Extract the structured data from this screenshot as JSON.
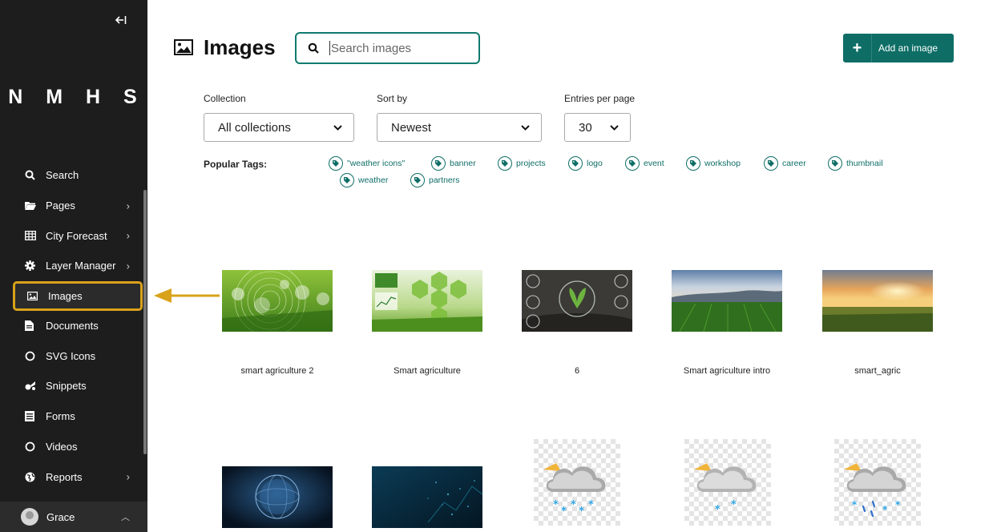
{
  "sidebar": {
    "brand": "N M H S",
    "collapse_glyph": "⇤",
    "items": [
      {
        "label": "Search",
        "icon": "search-icon",
        "has_submenu": false
      },
      {
        "label": "Pages",
        "icon": "folder-icon",
        "has_submenu": true
      },
      {
        "label": "City Forecast",
        "icon": "table-icon",
        "has_submenu": true
      },
      {
        "label": "Layer Manager",
        "icon": "gear-icon",
        "has_submenu": true
      },
      {
        "label": "Images",
        "icon": "image-icon",
        "has_submenu": false,
        "active": true
      },
      {
        "label": "Documents",
        "icon": "document-icon",
        "has_submenu": false
      },
      {
        "label": "SVG Icons",
        "icon": "circle-icon",
        "has_submenu": false
      },
      {
        "label": "Snippets",
        "icon": "snippet-icon",
        "has_submenu": false
      },
      {
        "label": "Forms",
        "icon": "form-icon",
        "has_submenu": false
      },
      {
        "label": "Videos",
        "icon": "circle-icon",
        "has_submenu": false
      },
      {
        "label": "Reports",
        "icon": "globe-icon",
        "has_submenu": true
      }
    ],
    "user": {
      "name": "Grace"
    }
  },
  "header": {
    "title": "Images",
    "search_placeholder": "Search images",
    "add_button": "Add an image"
  },
  "filters": {
    "collection": {
      "label": "Collection",
      "value": "All collections"
    },
    "sort": {
      "label": "Sort by",
      "value": "Newest"
    },
    "entries": {
      "label": "Entries per page",
      "value": "30"
    }
  },
  "tags": {
    "label": "Popular Tags:",
    "items": [
      "\"weather icons\"",
      "banner",
      "projects",
      "logo",
      "event",
      "workshop",
      "career",
      "thumbnail",
      "weather",
      "partners"
    ]
  },
  "images": [
    {
      "title": "smart agriculture 2",
      "kind": "smart-agri-green"
    },
    {
      "title": "Smart agriculture",
      "kind": "smart-agri-hex"
    },
    {
      "title": "6",
      "kind": "sprout-soil"
    },
    {
      "title": "Smart agriculture intro",
      "kind": "field-blue-sky"
    },
    {
      "title": "smart_agric",
      "kind": "field-sunset"
    },
    {
      "title": "",
      "kind": "digital-globe"
    },
    {
      "title": "",
      "kind": "digital-particles"
    },
    {
      "title": "",
      "kind": "weather-snow-sun"
    },
    {
      "title": "",
      "kind": "weather-snow-light"
    },
    {
      "title": "",
      "kind": "weather-sleet"
    }
  ],
  "colors": {
    "accent": "#0e6e66",
    "highlight": "#d9a21b",
    "sidebar_bg": "#1d1d1d"
  }
}
